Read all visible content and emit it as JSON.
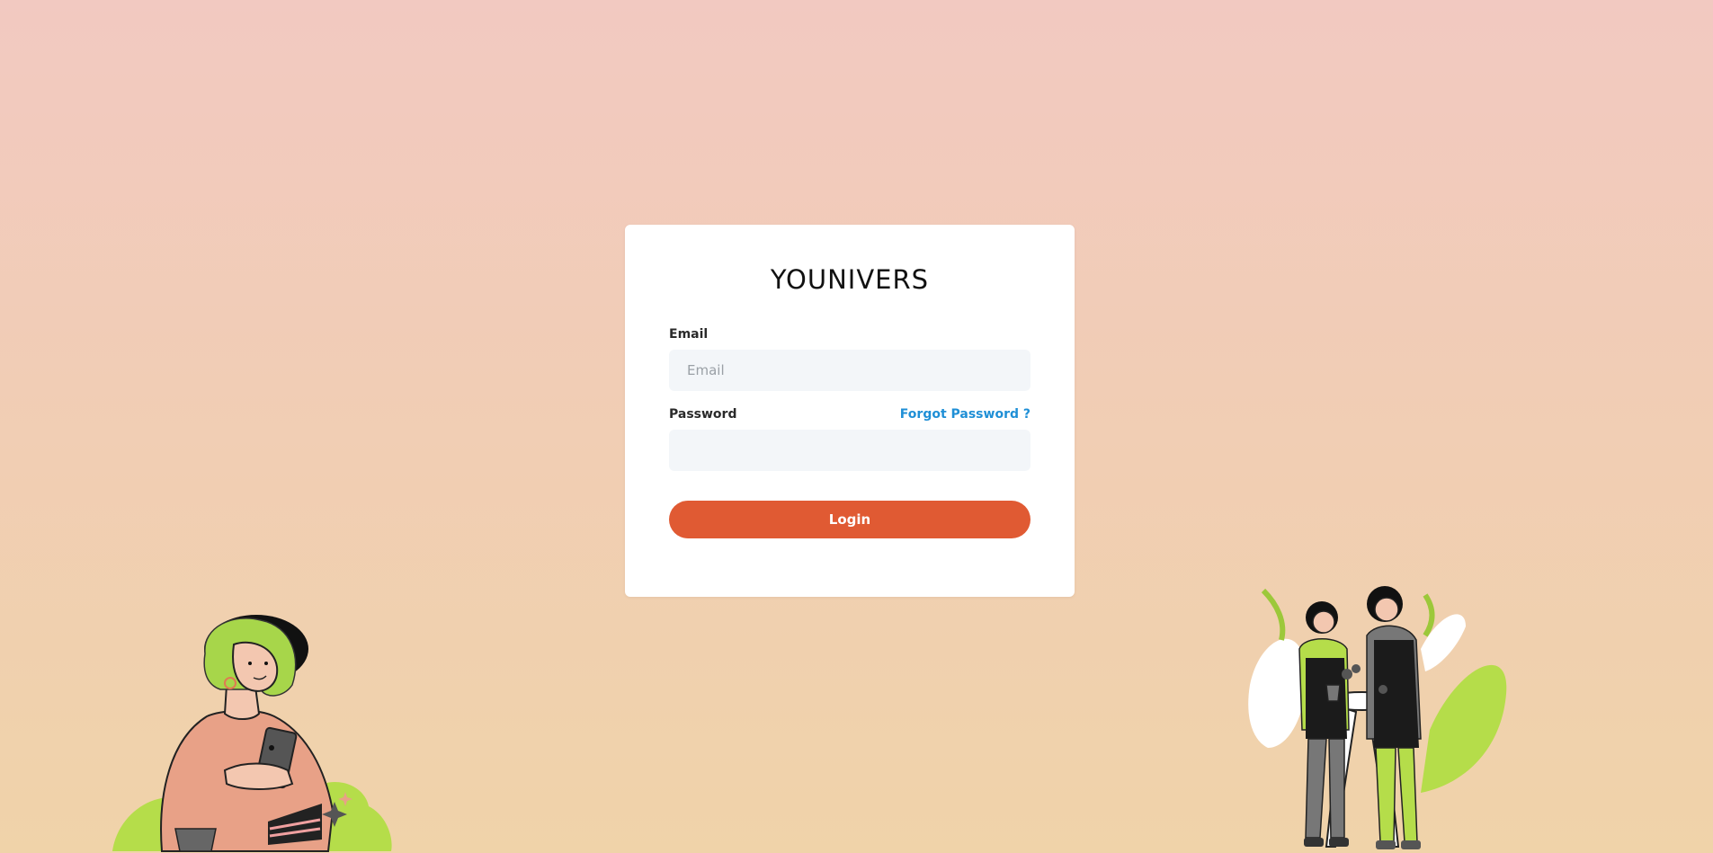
{
  "brand": {
    "title": "YOUNIVERS"
  },
  "form": {
    "email_label": "Email",
    "email_placeholder": "Email",
    "email_value": "",
    "password_label": "Password",
    "password_value": "",
    "forgot_link": "Forgot Password ?",
    "login_button": "Login"
  },
  "colors": {
    "accent": "#e05a33",
    "link": "#1f8fd6",
    "input_bg": "#f3f6f9",
    "background_top": "#f2c9c1",
    "background_bottom": "#f0d3a9",
    "illustration_green": "#b5dd4a"
  },
  "illustrations": {
    "left": "woman-with-phone-illustration",
    "right": "two-women-with-plant-illustration"
  }
}
